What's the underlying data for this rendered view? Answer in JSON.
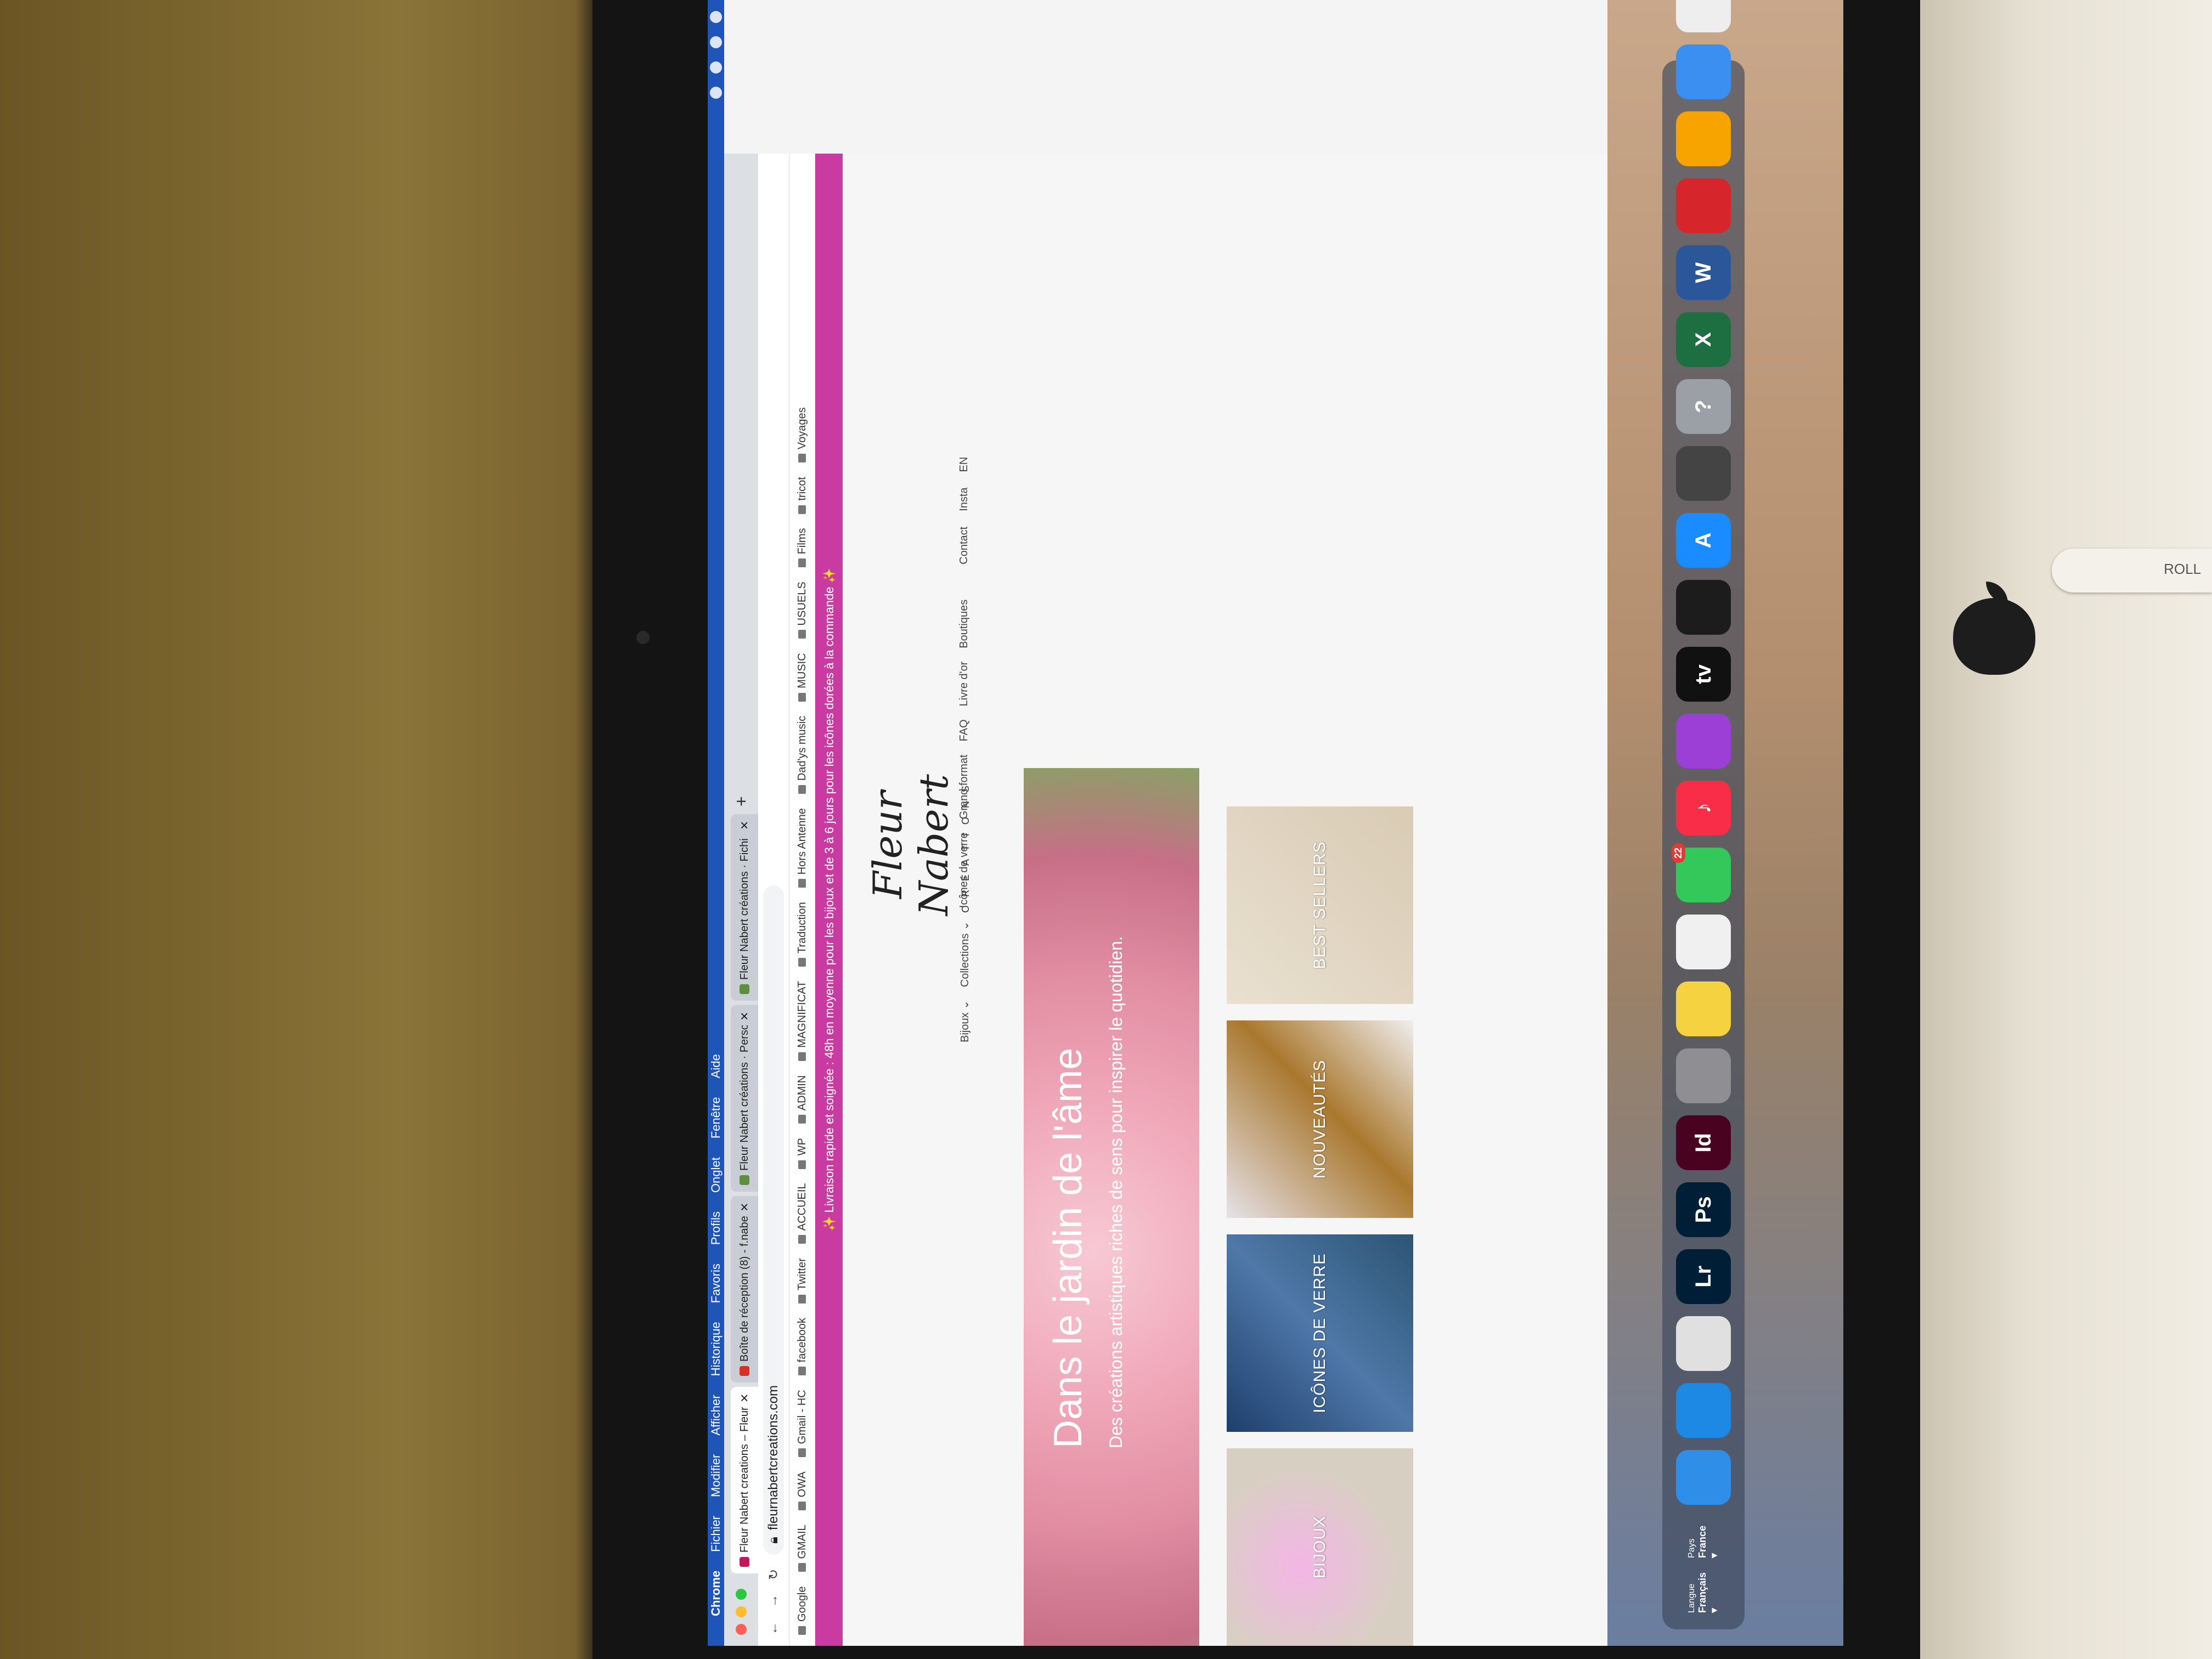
{
  "menubar": {
    "app": "Chrome",
    "items": [
      "Fichier",
      "Modifier",
      "Afficher",
      "Historique",
      "Favoris",
      "Profils",
      "Onglet",
      "Fenêtre",
      "Aide"
    ]
  },
  "tabs": [
    {
      "label": "Fleur Nabert creations – Fleur N",
      "active": true,
      "color": "#c2185b"
    },
    {
      "label": "Boîte de réception (8) - f.nabe",
      "active": false,
      "color": "#d93025"
    },
    {
      "label": "Fleur Nabert créations · Perso",
      "active": false,
      "color": "#5e8e3e"
    },
    {
      "label": "Fleur Nabert créations · Fichi",
      "active": false,
      "color": "#5e8e3e"
    }
  ],
  "omnibox": {
    "url": "fleurnabertcreations.com"
  },
  "bookmarks": [
    "Google",
    "GMAIL",
    "OWA",
    "Gmail - HC",
    "facebook",
    "Twitter",
    "ACCUEIL",
    "WP",
    "ADMIN",
    "MAGNIFICAT",
    "Traduction",
    "Hors Antenne",
    "Dad'ys music",
    "MUSIC",
    "USUELS",
    "Films",
    "tricot",
    "Voyages"
  ],
  "promo": "✨ Livraison rapide et soignée : 48h en moyenne pour les bijoux et de 3 à 6 jours pour les icônes dorées à la commande ✨",
  "logo": {
    "script": "Fleur Nabert",
    "sub": "CRÉATIONS"
  },
  "nav": {
    "left": [
      "Bijoux ⌄",
      "Collections ⌄",
      "Icônes de verre",
      "Grand format",
      "FAQ",
      "Livre d'or",
      "Boutiques"
    ],
    "right": [
      "Contact",
      "Insta",
      "EN"
    ]
  },
  "hero": {
    "title": "Dans le jardin de l'âme",
    "subtitle": "Des créations artistiques riches de sens pour inspirer le quotidien."
  },
  "tiles": [
    "BIJOUX",
    "ICÔNES DE VERRE",
    "NOUVEAUTÉS",
    "BEST SELLERS"
  ],
  "dock": {
    "langue_label": "Langue",
    "langue_value": "Français ▾",
    "pays_label": "Pays",
    "pays_value": "France ▾",
    "apps": [
      {
        "name": "finder-icon",
        "label": "",
        "color": "#2f8fe8"
      },
      {
        "name": "safari-icon",
        "label": "",
        "color": "#1e88e5"
      },
      {
        "name": "chrome-icon",
        "label": "",
        "color": "#e0e0e0"
      },
      {
        "name": "lightroom-icon",
        "label": "Lr",
        "color": "#001e36"
      },
      {
        "name": "photoshop-icon",
        "label": "Ps",
        "color": "#001e36"
      },
      {
        "name": "indesign-icon",
        "label": "Id",
        "color": "#49021f"
      },
      {
        "name": "settings-icon",
        "label": "",
        "color": "#8e8e93"
      },
      {
        "name": "notes-icon",
        "label": "",
        "color": "#f5d340"
      },
      {
        "name": "photos-icon",
        "label": "",
        "color": "#f0f0f0"
      },
      {
        "name": "messages-icon",
        "label": "",
        "color": "#34c759",
        "badge": "22"
      },
      {
        "name": "music-icon",
        "label": "♪",
        "color": "#fa2d48"
      },
      {
        "name": "podcasts-icon",
        "label": "",
        "color": "#9b3fd6"
      },
      {
        "name": "tv-icon",
        "label": "tv",
        "color": "#111111"
      },
      {
        "name": "activity-monitor-icon",
        "label": "",
        "color": "#1c1c1c"
      },
      {
        "name": "app-store-icon",
        "label": "A",
        "color": "#1a8cff"
      },
      {
        "name": "screenshot-icon",
        "label": "",
        "color": "#444444"
      },
      {
        "name": "help-icon",
        "label": "?",
        "color": "#9aa0a6"
      },
      {
        "name": "excel-icon",
        "label": "X",
        "color": "#1d6f42"
      },
      {
        "name": "word-icon",
        "label": "W",
        "color": "#2b579a"
      },
      {
        "name": "acrobat-icon",
        "label": "",
        "color": "#d7262b"
      },
      {
        "name": "pages-icon",
        "label": "",
        "color": "#f7a400"
      },
      {
        "name": "mail-icon",
        "label": "",
        "color": "#3a8ff0"
      },
      {
        "name": "document-icon",
        "label": "",
        "color": "#eeeeee"
      },
      {
        "name": "folder-icon",
        "label": "",
        "color": "#7eb3f2"
      }
    ]
  },
  "pencil_text": "ROLL"
}
